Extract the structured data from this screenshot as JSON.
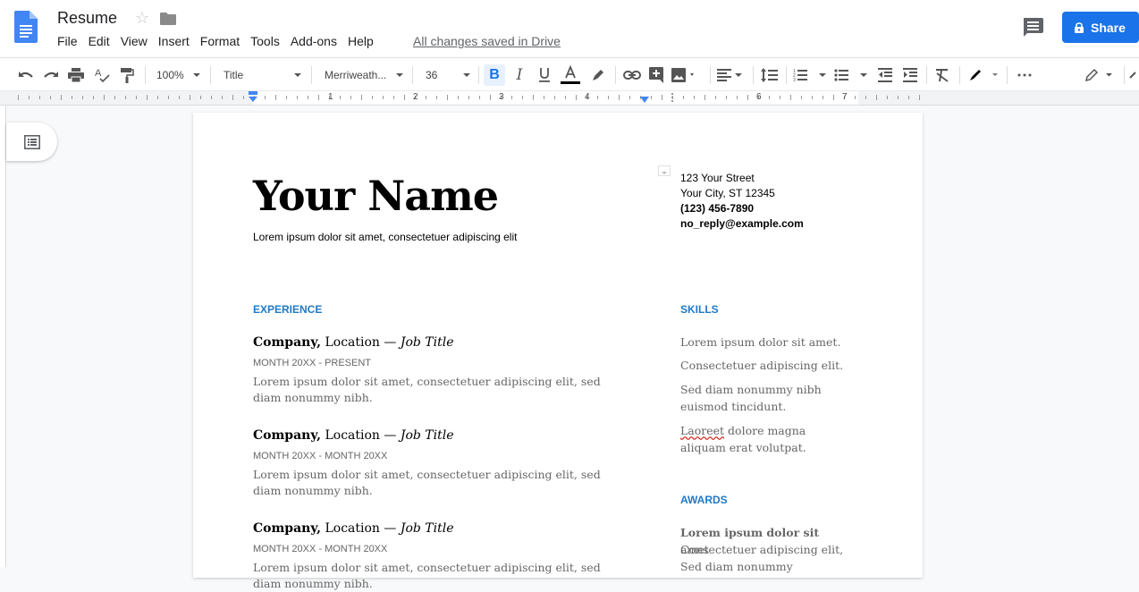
{
  "app": {
    "doc_title": "Resume",
    "saved_status": "All changes saved in Drive",
    "menu": [
      "File",
      "Edit",
      "View",
      "Insert",
      "Format",
      "Tools",
      "Add-ons",
      "Help"
    ],
    "share_label": "Share"
  },
  "toolbar": {
    "zoom": "100%",
    "style": "Title",
    "font": "Merriweath...",
    "font_size": "36",
    "text_color": "#000000"
  },
  "ruler": {
    "numbers": [
      "1",
      "2",
      "3",
      "4",
      "6",
      "7"
    ]
  },
  "document": {
    "name": "Your Name",
    "tagline": "Lorem ipsum dolor sit amet, consectetuer adipiscing elit",
    "address": {
      "street": "123 Your Street",
      "city": "Your City, ST 12345",
      "phone": "(123) 456-7890",
      "email": "no_reply@example.com"
    },
    "experience": {
      "heading": "EXPERIENCE",
      "jobs": [
        {
          "company": "Company,",
          "location": " Location — ",
          "title": "Job Title",
          "dates": "MONTH 20XX - PRESENT",
          "desc": "Lorem ipsum dolor sit amet, consectetuer adipiscing elit, sed diam nonummy nibh."
        },
        {
          "company": "Company,",
          "location": " Location — ",
          "title": "Job Title",
          "dates": "MONTH 20XX - MONTH 20XX",
          "desc": "Lorem ipsum dolor sit amet, consectetuer adipiscing elit, sed diam nonummy nibh."
        },
        {
          "company": "Company,",
          "location": " Location — ",
          "title": "Job Title",
          "dates": "MONTH 20XX - MONTH 20XX",
          "desc": "Lorem ipsum dolor sit amet, consectetuer adipiscing elit, sed diam nonummy nibh."
        }
      ]
    },
    "skills": {
      "heading": "SKILLS",
      "items": [
        "Lorem ipsum dolor sit amet.",
        "Consectetuer adipiscing elit.",
        "Sed diam nonummy nibh euismod tincidunt.",
        {
          "misspelled": "Laoreet",
          "rest": " dolore magna aliquam erat volutpat."
        }
      ]
    },
    "awards": {
      "heading": "AWARDS",
      "line1_bold": "Lorem ipsum dolor sit",
      "line1_rest": " amet",
      "line2": "Consectetuer adipiscing elit,",
      "line3": "Sed diam nonummy"
    }
  },
  "colors": {
    "accent": "#1a73e8",
    "heading": "#2079c7"
  }
}
